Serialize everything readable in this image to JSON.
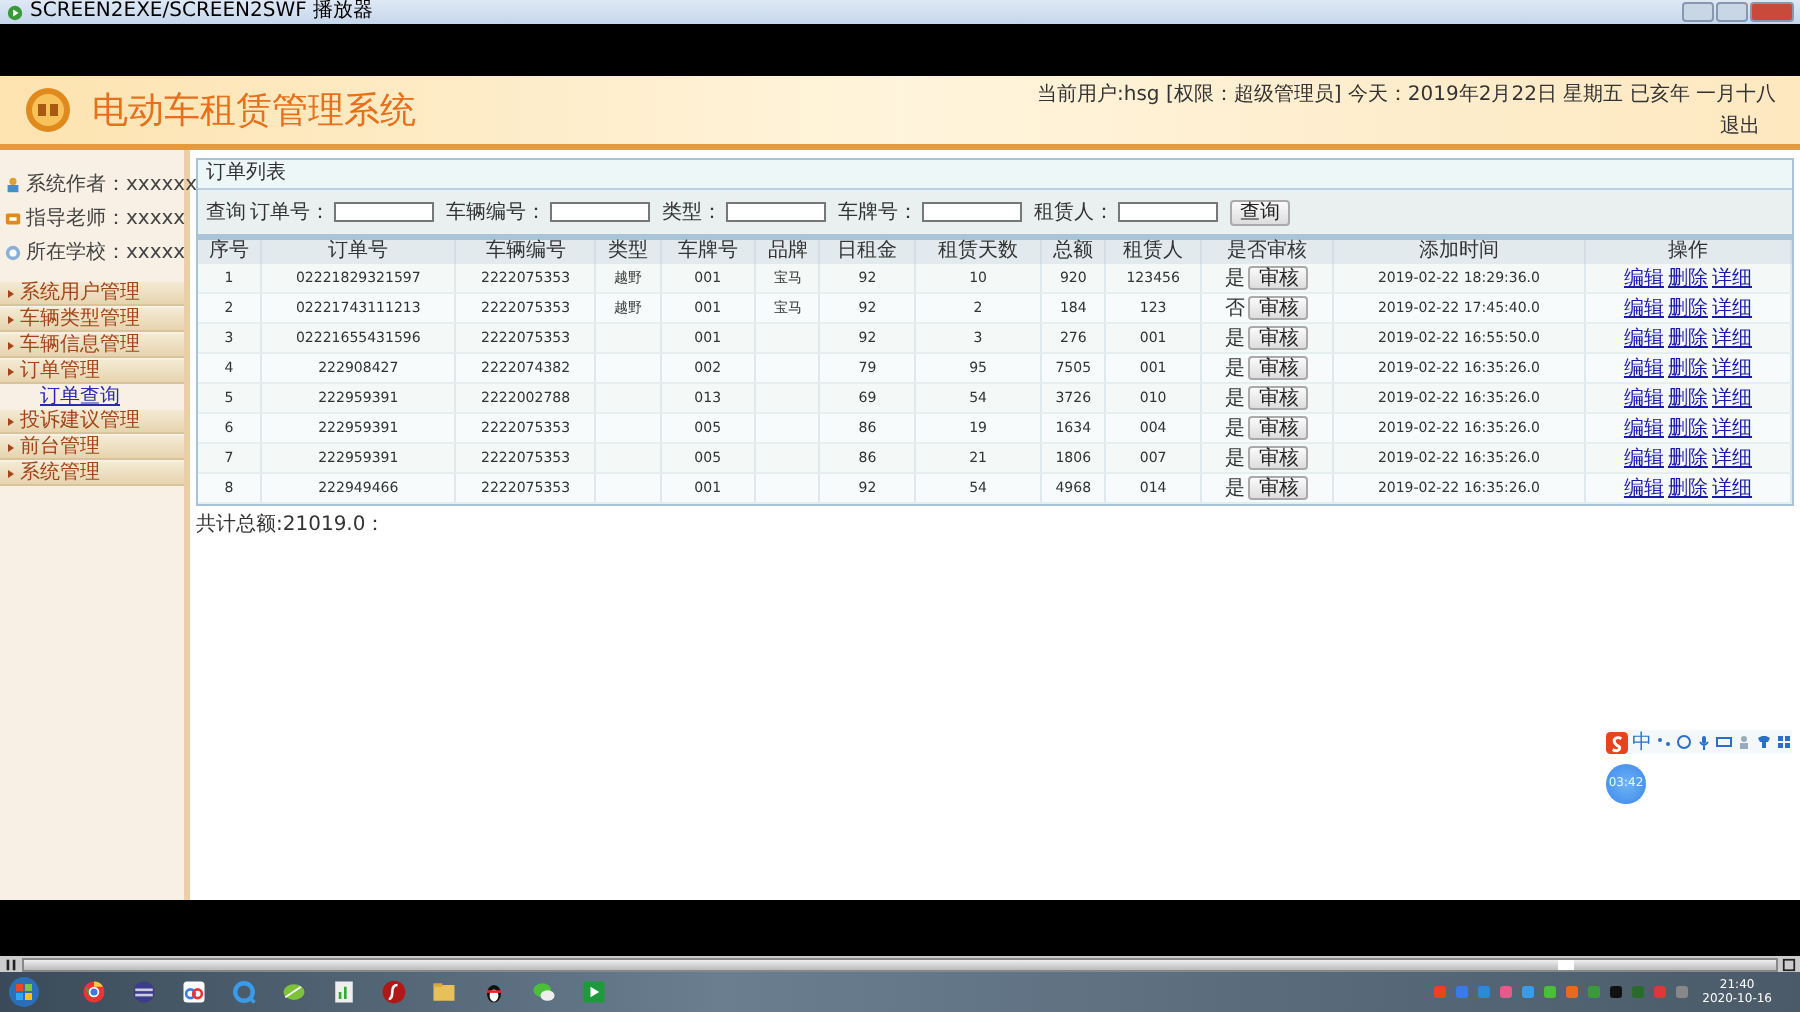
{
  "window": {
    "title": "SCREEN2EXE/SCREEN2SWF 播放器"
  },
  "header": {
    "app_title": "电动车租赁管理系统",
    "user_info": "当前用户:hsg [权限：超级管理员] 今天：2019年2月22日 星期五 已亥年 一月十八",
    "logout": "退出"
  },
  "sidebar": {
    "info": [
      {
        "kind": "author",
        "text": "系统作者：xxxxxx"
      },
      {
        "kind": "teacher",
        "text": "指导老师：xxxxx"
      },
      {
        "kind": "school",
        "text": "所在学校：xxxxx"
      }
    ],
    "menu": [
      {
        "label": "系统用户管理"
      },
      {
        "label": "车辆类型管理"
      },
      {
        "label": "车辆信息管理"
      },
      {
        "label": "订单管理",
        "children": [
          {
            "label": "订单查询",
            "selected": true
          }
        ]
      },
      {
        "label": "投诉建议管理"
      },
      {
        "label": "前台管理"
      },
      {
        "label": "系统管理"
      }
    ]
  },
  "panel": {
    "title": "订单列表",
    "search": {
      "label": "查询",
      "fields": [
        {
          "label": "订单号："
        },
        {
          "label": "车辆编号："
        },
        {
          "label": "类型："
        },
        {
          "label": "车牌号："
        },
        {
          "label": "租赁人："
        }
      ],
      "button": "查询"
    },
    "columns": [
      "序号",
      "订单号",
      "车辆编号",
      "类型",
      "车牌号",
      "品牌",
      "日租金",
      "租赁天数",
      "总额",
      "租赁人",
      "是否审核",
      "添加时间",
      "操作"
    ],
    "rows": [
      {
        "no": "1",
        "order_no": "02221829321597",
        "vehicle_no": "2222075353",
        "type": "越野",
        "plate": "001",
        "brand": "宝马",
        "daily_rent": "92",
        "days": "10",
        "total": "920",
        "renter": "123456",
        "audited": "是",
        "audit_button": "审核",
        "added_time": "2019-02-22 18:29:36.0",
        "actions": [
          "编辑",
          "删除",
          "详细"
        ]
      },
      {
        "no": "2",
        "order_no": "02221743111213",
        "vehicle_no": "2222075353",
        "type": "越野",
        "plate": "001",
        "brand": "宝马",
        "daily_rent": "92",
        "days": "2",
        "total": "184",
        "renter": "123",
        "audited": "否",
        "audit_button": "审核",
        "added_time": "2019-02-22 17:45:40.0",
        "actions": [
          "编辑",
          "删除",
          "详细"
        ]
      },
      {
        "no": "3",
        "order_no": "02221655431596",
        "vehicle_no": "2222075353",
        "plate": "001",
        "daily_rent": "92",
        "days": "3",
        "total": "276",
        "renter": "001",
        "audited": "是",
        "audit_button": "审核",
        "added_time": "2019-02-22 16:55:50.0",
        "actions": [
          "编辑",
          "删除",
          "详细"
        ]
      },
      {
        "no": "4",
        "order_no": "222908427",
        "vehicle_no": "2222074382",
        "plate": "002",
        "daily_rent": "79",
        "days": "95",
        "total": "7505",
        "renter": "001",
        "audited": "是",
        "audit_button": "审核",
        "added_time": "2019-02-22 16:35:26.0",
        "actions": [
          "编辑",
          "删除",
          "详细"
        ]
      },
      {
        "no": "5",
        "order_no": "222959391",
        "vehicle_no": "2222002788",
        "plate": "013",
        "daily_rent": "69",
        "days": "54",
        "total": "3726",
        "renter": "010",
        "audited": "是",
        "audit_button": "审核",
        "added_time": "2019-02-22 16:35:26.0",
        "actions": [
          "编辑",
          "删除",
          "详细"
        ]
      },
      {
        "no": "6",
        "order_no": "222959391",
        "vehicle_no": "2222075353",
        "plate": "005",
        "daily_rent": "86",
        "days": "19",
        "total": "1634",
        "renter": "004",
        "audited": "是",
        "audit_button": "审核",
        "added_time": "2019-02-22 16:35:26.0",
        "actions": [
          "编辑",
          "删除",
          "详细"
        ]
      },
      {
        "no": "7",
        "order_no": "222959391",
        "vehicle_no": "2222075353",
        "plate": "005",
        "daily_rent": "86",
        "days": "21",
        "total": "1806",
        "renter": "007",
        "audited": "是",
        "audit_button": "审核",
        "added_time": "2019-02-22 16:35:26.0",
        "actions": [
          "编辑",
          "删除",
          "详细"
        ]
      },
      {
        "no": "8",
        "order_no": "222949466",
        "vehicle_no": "2222075353",
        "plate": "001",
        "daily_rent": "92",
        "days": "54",
        "total": "4968",
        "renter": "014",
        "audited": "是",
        "audit_button": "审核",
        "added_time": "2019-02-22 16:35:26.0",
        "actions": [
          "编辑",
          "删除",
          "详细"
        ]
      }
    ],
    "total": "共计总额:21019.0："
  },
  "ime_toolbar": {
    "mode": "中"
  },
  "timer_badge": {
    "text": "03:42"
  },
  "player": {
    "level": 0.88
  },
  "taskbar": {
    "time": "21:40",
    "date": "2020-10-16"
  }
}
